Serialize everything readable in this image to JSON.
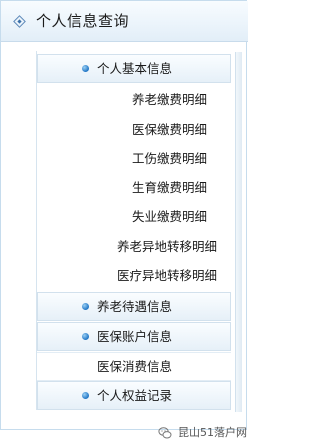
{
  "panel": {
    "title": "个人信息查询"
  },
  "menu": {
    "basic": "个人基本信息",
    "pension_detail": "养老缴费明细",
    "medical_detail": "医保缴费明细",
    "injury_detail": "工伤缴费明细",
    "maternity_detail": "生育缴费明细",
    "unemployment_detail": "失业缴费明细",
    "pension_transfer": "养老异地转移明细",
    "medical_transfer": "医疗异地转移明细",
    "pension_benefit": "养老待遇信息",
    "medical_account": "医保账户信息",
    "medical_consumption": "医保消费信息",
    "rights_record": "个人权益记录"
  },
  "watermark": {
    "text": "昆山51落户网"
  },
  "icons": [
    "diamond-icon",
    "bullet-icon",
    "wechat-logo"
  ]
}
